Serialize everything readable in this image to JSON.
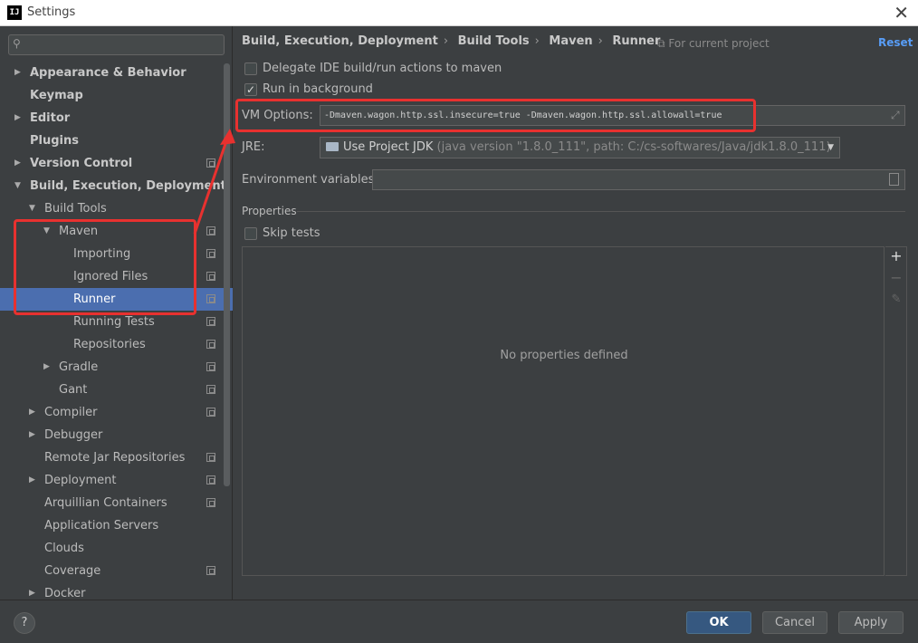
{
  "window": {
    "title": "Settings",
    "app_icon_text": "IJ"
  },
  "search": {
    "placeholder": ""
  },
  "sidebar": {
    "items": [
      {
        "label": "Appearance & Behavior",
        "arrow": "▶"
      },
      {
        "label": "Keymap",
        "arrow": ""
      },
      {
        "label": "Editor",
        "arrow": "▶"
      },
      {
        "label": "Plugins",
        "arrow": ""
      },
      {
        "label": "Version Control",
        "arrow": "▶"
      },
      {
        "label": "Build, Execution, Deployment",
        "arrow": "▼"
      },
      {
        "label": "Build Tools",
        "arrow": "▼"
      },
      {
        "label": "Maven",
        "arrow": "▼"
      },
      {
        "label": "Importing",
        "arrow": ""
      },
      {
        "label": "Ignored Files",
        "arrow": ""
      },
      {
        "label": "Runner",
        "arrow": ""
      },
      {
        "label": "Running Tests",
        "arrow": ""
      },
      {
        "label": "Repositories",
        "arrow": ""
      },
      {
        "label": "Gradle",
        "arrow": "▶"
      },
      {
        "label": "Gant",
        "arrow": ""
      },
      {
        "label": "Compiler",
        "arrow": "▶"
      },
      {
        "label": "Debugger",
        "arrow": "▶"
      },
      {
        "label": "Remote Jar Repositories",
        "arrow": ""
      },
      {
        "label": "Deployment",
        "arrow": "▶"
      },
      {
        "label": "Arquillian Containers",
        "arrow": ""
      },
      {
        "label": "Application Servers",
        "arrow": ""
      },
      {
        "label": "Clouds",
        "arrow": ""
      },
      {
        "label": "Coverage",
        "arrow": ""
      },
      {
        "label": "Docker",
        "arrow": "▶"
      }
    ]
  },
  "breadcrumb": {
    "items": [
      "Build, Execution, Deployment",
      "Build Tools",
      "Maven",
      "Runner"
    ],
    "separator": "›"
  },
  "header": {
    "for_project": "For current project",
    "reset": "Reset"
  },
  "runner": {
    "delegate_label": "Delegate IDE build/run actions to maven",
    "delegate_checked": false,
    "background_label": "Run in background",
    "background_checked": true,
    "check_mark": "✓",
    "vm_options_label": "VM Options:",
    "vm_options_value": "-Dmaven.wagon.http.ssl.insecure=true -Dmaven.wagon.http.ssl.allowall=true",
    "jre_label": "JRE:",
    "jre_name": "Use Project JDK",
    "jre_detail": "(java version \"1.8.0_111\", path: C:/cs-softwares/Java/jdk1.8.0_111)",
    "env_label": "Environment variables:",
    "env_value": ""
  },
  "properties": {
    "section_title": "Properties",
    "skip_tests_label": "Skip tests",
    "skip_tests_checked": false,
    "empty_text": "No properties defined",
    "add": "+",
    "remove": "−",
    "edit": "✎"
  },
  "footer": {
    "help": "?",
    "ok": "OK",
    "cancel": "Cancel",
    "apply": "Apply"
  },
  "colors": {
    "accent": "#4b6eaf",
    "annotation": "#e8312f",
    "link": "#589df6",
    "background": "#3c3f41"
  }
}
